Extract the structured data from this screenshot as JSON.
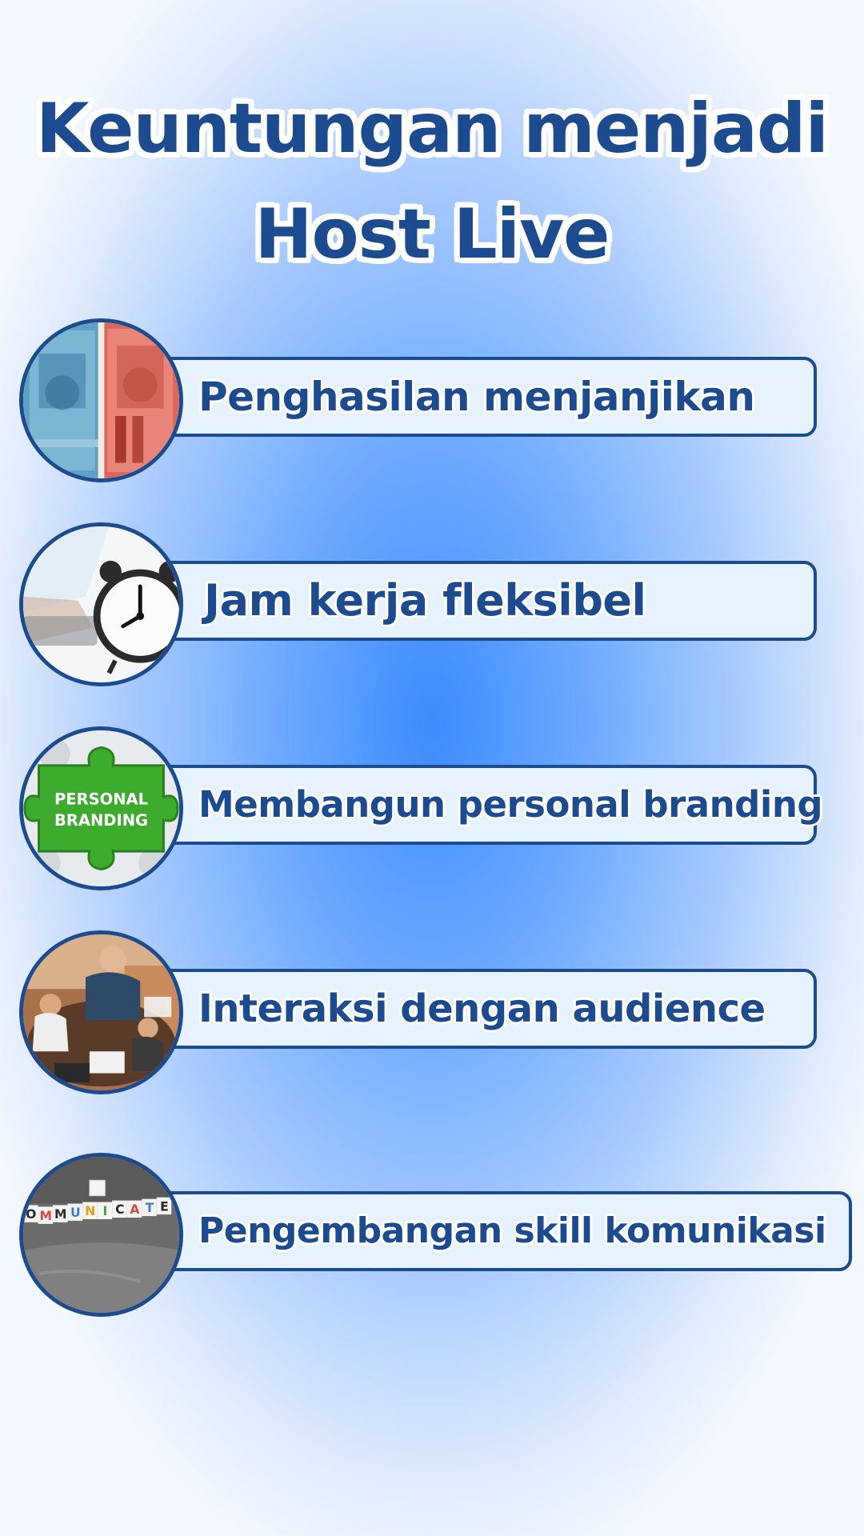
{
  "title": {
    "line1": "Keuntungan menjadi",
    "line2": "Host Live"
  },
  "benefits": [
    {
      "label": "Penghasilan menjanjikan",
      "icon": "money-banknotes-icon"
    },
    {
      "label": "Jam kerja fleksibel",
      "icon": "alarm-clock-icon"
    },
    {
      "label": "Membangun personal branding",
      "icon": "puzzle-personal-branding-icon",
      "image_text": "PERSONAL BRANDING"
    },
    {
      "label": "Interaksi dengan audience",
      "icon": "group-meeting-icon"
    },
    {
      "label": "Pengembangan skill komunikasi",
      "icon": "communicate-letter-cubes-icon",
      "image_text": "COMMUNICATE"
    }
  ],
  "colors": {
    "primary": "#1d4b8f",
    "bar_fill": "#e6f2fe",
    "background_center": "#3d8bfd",
    "background_edge": "#f3f7fe",
    "puzzle_green": "#3cab2e"
  }
}
